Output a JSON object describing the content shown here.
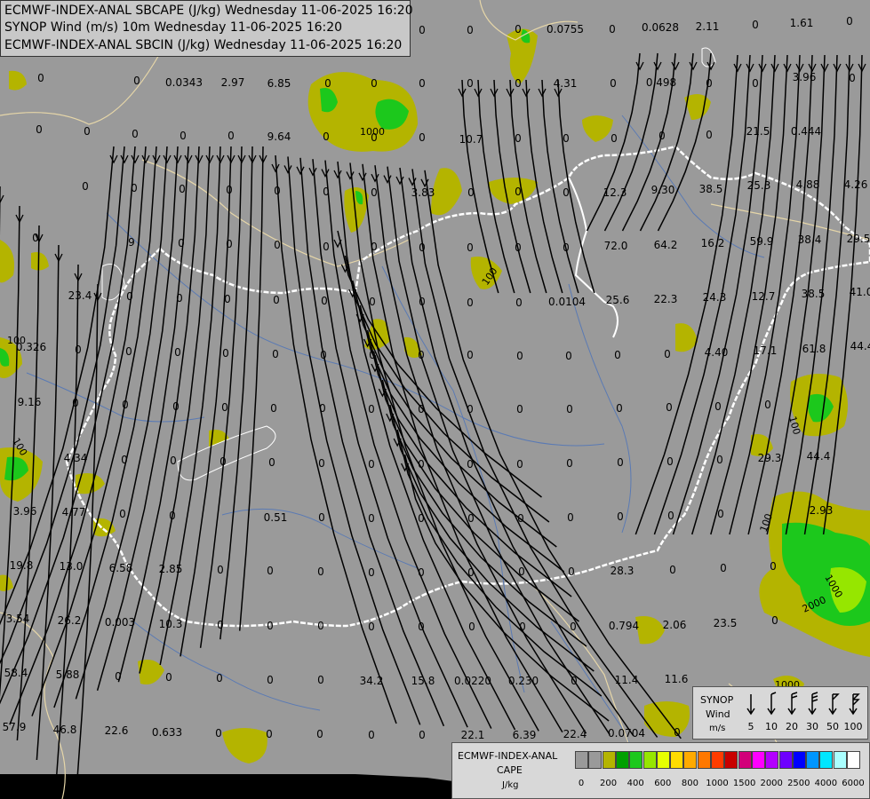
{
  "title_lines": [
    "ECMWF-INDEX-ANAL SBCAPE (J/kg) Wednesday 11-06-2025 16:20",
    "SYNOP Wind (m/s) 10m Wednesday 11-06-2025 16:20",
    "ECMWF-INDEX-ANAL SBCIN (J/kg) Wednesday 11-06-2025 16:20"
  ],
  "colors": {
    "background": "#9a9a9a",
    "cape_olive": "#b4b400",
    "cape_green": "#1cc81c",
    "cape_light_green": "#96e600",
    "border_country": "#ffffff",
    "border_region": "#e0d0a0",
    "rivers": "#5a7ab4",
    "streamlines": "#000000"
  },
  "cape_values": [
    [
      "0",
      46,
      92
    ],
    [
      "0",
      154,
      95
    ],
    [
      "0.0343",
      207,
      97
    ],
    [
      "2.97",
      262,
      97
    ],
    [
      "6.85",
      314,
      98
    ],
    [
      "0",
      369,
      98
    ],
    [
      "0",
      421,
      98
    ],
    [
      "0",
      475,
      98
    ],
    [
      "0",
      529,
      98
    ],
    [
      "0",
      583,
      98
    ],
    [
      "4.31",
      636,
      98
    ],
    [
      "0",
      690,
      98
    ],
    [
      "0.498",
      744,
      97
    ],
    [
      "0",
      798,
      98
    ],
    [
      "0",
      850,
      98
    ],
    [
      "3.96",
      905,
      91
    ],
    [
      "0",
      959,
      92
    ],
    [
      "0",
      44,
      150
    ],
    [
      "0",
      98,
      152
    ],
    [
      "0",
      152,
      155
    ],
    [
      "0",
      206,
      157
    ],
    [
      "0",
      260,
      157
    ],
    [
      "9.64",
      314,
      158
    ],
    [
      "0",
      367,
      158
    ],
    [
      "0",
      421,
      159
    ],
    [
      "0",
      475,
      159
    ],
    [
      "10.7",
      530,
      161
    ],
    [
      "0",
      583,
      160
    ],
    [
      "0",
      637,
      160
    ],
    [
      "0",
      691,
      160
    ],
    [
      "0",
      745,
      157
    ],
    [
      "0",
      798,
      156
    ],
    [
      "21.5",
      853,
      152
    ],
    [
      "0.444",
      907,
      152
    ],
    [
      "0",
      96,
      214
    ],
    [
      "0",
      151,
      216
    ],
    [
      "0",
      205,
      217
    ],
    [
      "0",
      258,
      218
    ],
    [
      "0",
      312,
      219
    ],
    [
      "0",
      367,
      220
    ],
    [
      "0",
      421,
      221
    ],
    [
      "3.83",
      476,
      221
    ],
    [
      "0",
      530,
      221
    ],
    [
      "0",
      583,
      220
    ],
    [
      "0",
      637,
      221
    ],
    [
      "12.3",
      692,
      221
    ],
    [
      "9.30",
      746,
      218
    ],
    [
      "38.5",
      800,
      217
    ],
    [
      "25.3",
      854,
      213
    ],
    [
      "4.88",
      909,
      212
    ],
    [
      "4.26",
      963,
      212
    ],
    [
      "0",
      40,
      272
    ],
    [
      "9",
      148,
      277
    ],
    [
      "0",
      204,
      278
    ],
    [
      "0",
      258,
      279
    ],
    [
      "0",
      312,
      280
    ],
    [
      "0",
      367,
      282
    ],
    [
      "0",
      421,
      282
    ],
    [
      "0",
      475,
      283
    ],
    [
      "0",
      529,
      283
    ],
    [
      "0",
      583,
      283
    ],
    [
      "0",
      637,
      283
    ],
    [
      "72.0",
      693,
      281
    ],
    [
      "64.2",
      749,
      280
    ],
    [
      "16.2",
      802,
      278
    ],
    [
      "59.9",
      857,
      276
    ],
    [
      "38.4",
      911,
      274
    ],
    [
      "29.5",
      966,
      273
    ],
    [
      "23.4",
      90,
      337
    ],
    [
      "0",
      146,
      338
    ],
    [
      "0",
      202,
      340
    ],
    [
      "0",
      256,
      341
    ],
    [
      "0",
      311,
      342
    ],
    [
      "0",
      365,
      343
    ],
    [
      "0",
      419,
      344
    ],
    [
      "0",
      475,
      344
    ],
    [
      "0",
      529,
      345
    ],
    [
      "0",
      584,
      345
    ],
    [
      "0.0104",
      638,
      344
    ],
    [
      "25.6",
      695,
      342
    ],
    [
      "22.3",
      749,
      341
    ],
    [
      "24.3",
      804,
      339
    ],
    [
      "12.7",
      859,
      338
    ],
    [
      "38.5",
      915,
      335
    ],
    [
      "41.0",
      969,
      333
    ],
    [
      "0.326",
      35,
      395
    ],
    [
      "0",
      88,
      398
    ],
    [
      "0",
      145,
      400
    ],
    [
      "0",
      200,
      401
    ],
    [
      "0",
      254,
      402
    ],
    [
      "0",
      310,
      403
    ],
    [
      "0",
      364,
      404
    ],
    [
      "0",
      419,
      404
    ],
    [
      "0",
      474,
      404
    ],
    [
      "0",
      529,
      404
    ],
    [
      "0",
      585,
      405
    ],
    [
      "0",
      640,
      405
    ],
    [
      "0",
      695,
      404
    ],
    [
      "0",
      751,
      403
    ],
    [
      "4.40",
      806,
      401
    ],
    [
      "17.1",
      861,
      399
    ],
    [
      "61.8",
      916,
      397
    ],
    [
      "44.4",
      970,
      394
    ],
    [
      "9.16",
      33,
      457
    ],
    [
      "0",
      85,
      458
    ],
    [
      "0",
      141,
      460
    ],
    [
      "0",
      198,
      462
    ],
    [
      "0",
      253,
      463
    ],
    [
      "0",
      308,
      464
    ],
    [
      "0",
      363,
      464
    ],
    [
      "0",
      418,
      465
    ],
    [
      "0",
      474,
      465
    ],
    [
      "0",
      529,
      465
    ],
    [
      "0",
      585,
      465
    ],
    [
      "0",
      641,
      465
    ],
    [
      "0",
      697,
      464
    ],
    [
      "0",
      753,
      463
    ],
    [
      "0",
      808,
      462
    ],
    [
      "0",
      864,
      460
    ],
    [
      "4.34",
      85,
      520
    ],
    [
      "0",
      140,
      522
    ],
    [
      "0",
      195,
      523
    ],
    [
      "0",
      251,
      524
    ],
    [
      "0",
      306,
      525
    ],
    [
      "0",
      362,
      526
    ],
    [
      "0",
      418,
      527
    ],
    [
      "0",
      474,
      527
    ],
    [
      "0",
      529,
      527
    ],
    [
      "0",
      585,
      527
    ],
    [
      "0",
      641,
      526
    ],
    [
      "0",
      698,
      525
    ],
    [
      "0",
      754,
      524
    ],
    [
      "0",
      810,
      522
    ],
    [
      "29.3",
      866,
      520
    ],
    [
      "44.4",
      921,
      518
    ],
    [
      "3.96",
      28,
      580
    ],
    [
      "4.77",
      83,
      581
    ],
    [
      "0",
      138,
      583
    ],
    [
      "0",
      194,
      585
    ],
    [
      "0.51",
      310,
      587
    ],
    [
      "0",
      362,
      587
    ],
    [
      "0",
      418,
      588
    ],
    [
      "0",
      474,
      588
    ],
    [
      "0",
      530,
      588
    ],
    [
      "0",
      586,
      588
    ],
    [
      "0",
      642,
      587
    ],
    [
      "0",
      698,
      586
    ],
    [
      "0",
      755,
      585
    ],
    [
      "0",
      811,
      583
    ],
    [
      "2.93",
      924,
      579
    ],
    [
      "19.8",
      24,
      641
    ],
    [
      "13.0",
      80,
      642
    ],
    [
      "6.58",
      136,
      644
    ],
    [
      "2.85",
      192,
      645
    ],
    [
      "0",
      248,
      646
    ],
    [
      "0",
      304,
      647
    ],
    [
      "0",
      361,
      648
    ],
    [
      "0",
      418,
      649
    ],
    [
      "0",
      474,
      649
    ],
    [
      "0",
      530,
      649
    ],
    [
      "0",
      587,
      648
    ],
    [
      "0",
      643,
      648
    ],
    [
      "28.3",
      700,
      647
    ],
    [
      "0",
      757,
      646
    ],
    [
      "0",
      814,
      644
    ],
    [
      "0",
      870,
      642
    ],
    [
      "3.54",
      20,
      701
    ],
    [
      "26.2",
      78,
      703
    ],
    [
      "0.003",
      135,
      705
    ],
    [
      "10.3",
      192,
      707
    ],
    [
      "0",
      248,
      708
    ],
    [
      "0",
      304,
      709
    ],
    [
      "0",
      361,
      709
    ],
    [
      "0",
      418,
      710
    ],
    [
      "0",
      474,
      710
    ],
    [
      "0",
      531,
      710
    ],
    [
      "0",
      588,
      710
    ],
    [
      "0",
      645,
      710
    ],
    [
      "0.794",
      702,
      709
    ],
    [
      "2.06",
      759,
      708
    ],
    [
      "23.5",
      816,
      706
    ],
    [
      "0",
      872,
      703
    ],
    [
      "58.4",
      18,
      762
    ],
    [
      "5.88",
      76,
      764
    ],
    [
      "0",
      133,
      766
    ],
    [
      "0",
      190,
      767
    ],
    [
      "0",
      247,
      768
    ],
    [
      "0",
      304,
      770
    ],
    [
      "0",
      361,
      770
    ],
    [
      "34.2",
      418,
      771
    ],
    [
      "15.8",
      476,
      771
    ],
    [
      "0.0220",
      532,
      771
    ],
    [
      "0.230",
      589,
      771
    ],
    [
      "0",
      646,
      771
    ],
    [
      "11.4",
      705,
      770
    ],
    [
      "11.6",
      761,
      769
    ],
    [
      "57.9",
      16,
      823
    ],
    [
      "46.8",
      73,
      826
    ],
    [
      "22.6",
      131,
      827
    ],
    [
      "0.633",
      188,
      829
    ],
    [
      "0",
      246,
      830
    ],
    [
      "0",
      303,
      831
    ],
    [
      "0",
      360,
      831
    ],
    [
      "0",
      418,
      832
    ],
    [
      "0",
      475,
      832
    ],
    [
      "22.1",
      532,
      832
    ],
    [
      "6.39",
      590,
      832
    ],
    [
      "22.4",
      647,
      831
    ],
    [
      "0.0704",
      705,
      830
    ],
    [
      "0",
      762,
      829
    ],
    [
      "2.26",
      818,
      828
    ],
    [
      "0",
      876,
      826
    ],
    [
      "2.23",
      933,
      823
    ],
    [
      "0.0755",
      636,
      37
    ],
    [
      "0",
      689,
      37
    ],
    [
      "0.0628",
      743,
      35
    ],
    [
      "2.11",
      796,
      34
    ],
    [
      "0",
      850,
      32
    ],
    [
      "1.61",
      902,
      30
    ],
    [
      "0",
      956,
      28
    ],
    [
      "0",
      475,
      38
    ],
    [
      "0",
      529,
      38
    ],
    [
      "0",
      583,
      37
    ]
  ],
  "contour_labels": [
    "1000",
    "100",
    "100",
    "100",
    "100",
    "100",
    "200",
    "1000",
    "1000",
    "2000",
    "1000"
  ],
  "wind_legend": {
    "title_line1": "SYNOP",
    "title_line2": "Wind",
    "unit": "m/s",
    "speeds": [
      "5",
      "10",
      "20",
      "30",
      "50",
      "100"
    ]
  },
  "cape_legend": {
    "title": "ECMWF-INDEX-ANAL",
    "subtitle": "CAPE",
    "unit": "J/kg",
    "colors": [
      "#9a9a9a",
      "#9a9a9a",
      "#b4b400",
      "#00a000",
      "#1cc81c",
      "#96e600",
      "#e6ff00",
      "#ffdc00",
      "#ffaa00",
      "#ff7800",
      "#ff3c00",
      "#c80000",
      "#d2007a",
      "#ff00ff",
      "#b400ff",
      "#6e00ff",
      "#0000ff",
      "#0096ff",
      "#00e6ff",
      "#aaffff",
      "#ffffff"
    ],
    "ticks": [
      "0",
      "200",
      "400",
      "600",
      "800",
      "1000",
      "1500",
      "2000",
      "2500",
      "4000",
      "6000"
    ]
  }
}
